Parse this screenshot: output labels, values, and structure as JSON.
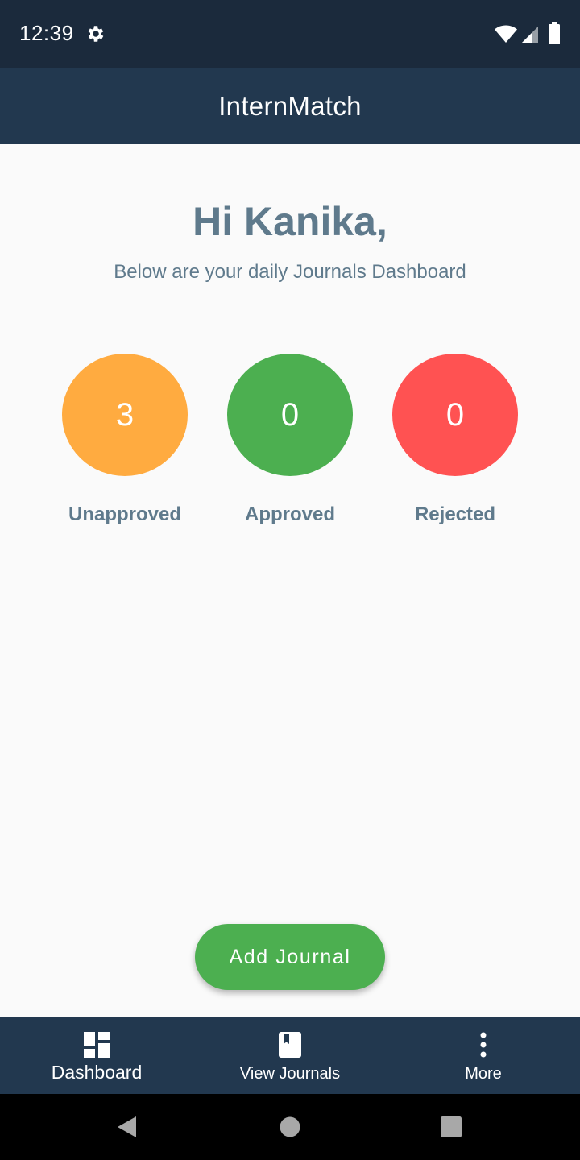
{
  "status_bar": {
    "time": "12:39"
  },
  "app_bar": {
    "title": "InternMatch"
  },
  "dashboard": {
    "greeting": "Hi Kanika,",
    "subtitle": "Below are your daily Journals Dashboard",
    "stats": [
      {
        "label": "Unapproved",
        "value": "3",
        "color": "#ffab40"
      },
      {
        "label": "Approved",
        "value": "0",
        "color": "#4caf50"
      },
      {
        "label": "Rejected",
        "value": "0",
        "color": "#ff5252"
      }
    ]
  },
  "actions": {
    "add_journal_label": "Add Journal"
  },
  "bottom_nav": {
    "items": [
      {
        "label": "Dashboard",
        "icon": "dashboard-icon",
        "active": true
      },
      {
        "label": "View Journals",
        "icon": "book-icon",
        "active": false
      },
      {
        "label": "More",
        "icon": "more-vertical-icon",
        "active": false
      }
    ]
  },
  "colors": {
    "status_bar": "#1b2a3c",
    "app_bar": "#22384f",
    "text_muted": "#5f7a8c",
    "accent_green": "#4caf50"
  }
}
